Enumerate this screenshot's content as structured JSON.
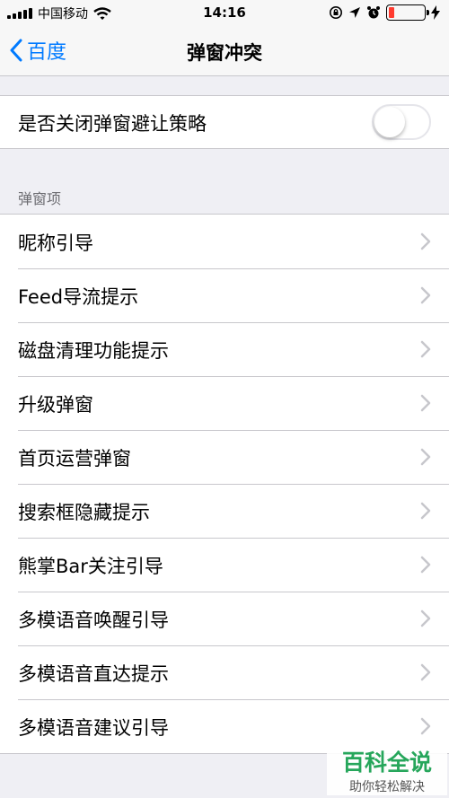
{
  "status_bar": {
    "carrier": "中国移动",
    "time": "14:16",
    "battery_level": 0.15
  },
  "nav": {
    "back_label": "百度",
    "title": "弹窗冲突"
  },
  "toggle_cell": {
    "label": "是否关闭弹窗避让策略",
    "enabled": false
  },
  "section": {
    "header": "弹窗项",
    "items": [
      {
        "label": "昵称引导"
      },
      {
        "label": "Feed导流提示"
      },
      {
        "label": "磁盘清理功能提示"
      },
      {
        "label": "升级弹窗"
      },
      {
        "label": "首页运营弹窗"
      },
      {
        "label": "搜索框隐藏提示"
      },
      {
        "label": "熊掌Bar关注引导"
      },
      {
        "label": "多模语音唤醒引导"
      },
      {
        "label": "多模语音直达提示"
      },
      {
        "label": "多模语音建议引导"
      }
    ]
  },
  "watermark": {
    "title": "百科全说",
    "subtitle": "助你轻松解决"
  },
  "colors": {
    "accent": "#007aff",
    "background": "#efeff4",
    "separator": "#c8c7cc",
    "battery_low": "#ff3b30",
    "watermark_green": "#26a65b"
  },
  "icons": [
    "signal-bars-icon",
    "wifi-icon",
    "orientation-lock-icon",
    "location-arrow-icon",
    "alarm-icon",
    "battery-icon",
    "charging-bolt-icon",
    "chevron-left-icon",
    "chevron-right-icon"
  ]
}
